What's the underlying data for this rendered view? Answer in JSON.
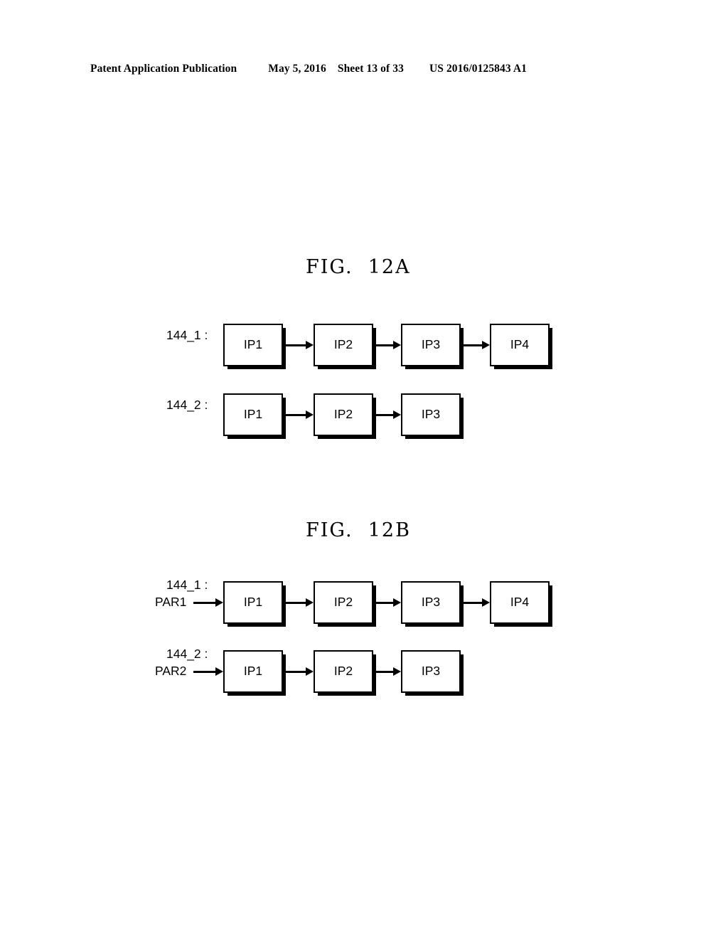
{
  "header": {
    "publication": "Patent Application Publication",
    "date": "May 5, 2016",
    "sheet": "Sheet 13 of 33",
    "patent_number": "US 2016/0125843 A1"
  },
  "figures": [
    {
      "id": "fig-12a",
      "title": "FIG.  12A",
      "rows": [
        {
          "id": "144_1",
          "label": "144_1 :",
          "input_label": null,
          "boxes": [
            {
              "label": "IP1"
            },
            {
              "label": "IP2"
            },
            {
              "label": "IP3"
            },
            {
              "label": "IP4"
            }
          ]
        },
        {
          "id": "144_2",
          "label": "144_2 :",
          "input_label": null,
          "boxes": [
            {
              "label": "IP1"
            },
            {
              "label": "IP2"
            },
            {
              "label": "IP3"
            }
          ]
        }
      ]
    },
    {
      "id": "fig-12b",
      "title": "FIG.  12B",
      "rows": [
        {
          "id": "144_1",
          "label": "144_1 :",
          "input_label": "PAR1",
          "boxes": [
            {
              "label": "IP1"
            },
            {
              "label": "IP2"
            },
            {
              "label": "IP3"
            },
            {
              "label": "IP4"
            }
          ]
        },
        {
          "id": "144_2",
          "label": "144_2 :",
          "input_label": "PAR2",
          "boxes": [
            {
              "label": "IP1"
            },
            {
              "label": "IP2"
            },
            {
              "label": "IP3"
            }
          ]
        }
      ]
    }
  ],
  "colors": {
    "ink": "#000000",
    "paper": "#ffffff"
  }
}
